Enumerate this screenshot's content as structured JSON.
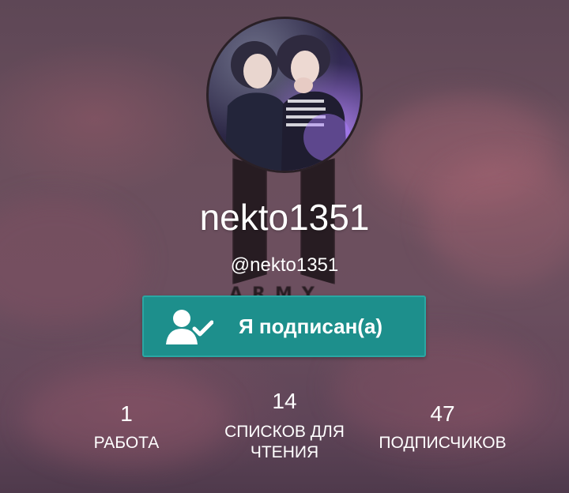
{
  "profile": {
    "username": "nekto1351",
    "handle": "@nekto1351",
    "background_logo_text": "ARMY"
  },
  "follow_button": {
    "label": "Я подписан(а)",
    "icon": "user-check-icon",
    "color": "#1d8f8c"
  },
  "stats": [
    {
      "value": "1",
      "label": "РАБОТА"
    },
    {
      "value": "14",
      "label": "СПИСКОВ ДЛЯ ЧТЕНИЯ"
    },
    {
      "value": "47",
      "label": "ПОДПИСЧИКОВ"
    }
  ],
  "theme": {
    "header_background": "#6b4f5d",
    "text_color": "#ffffff",
    "accent": "#1d8f8c"
  }
}
